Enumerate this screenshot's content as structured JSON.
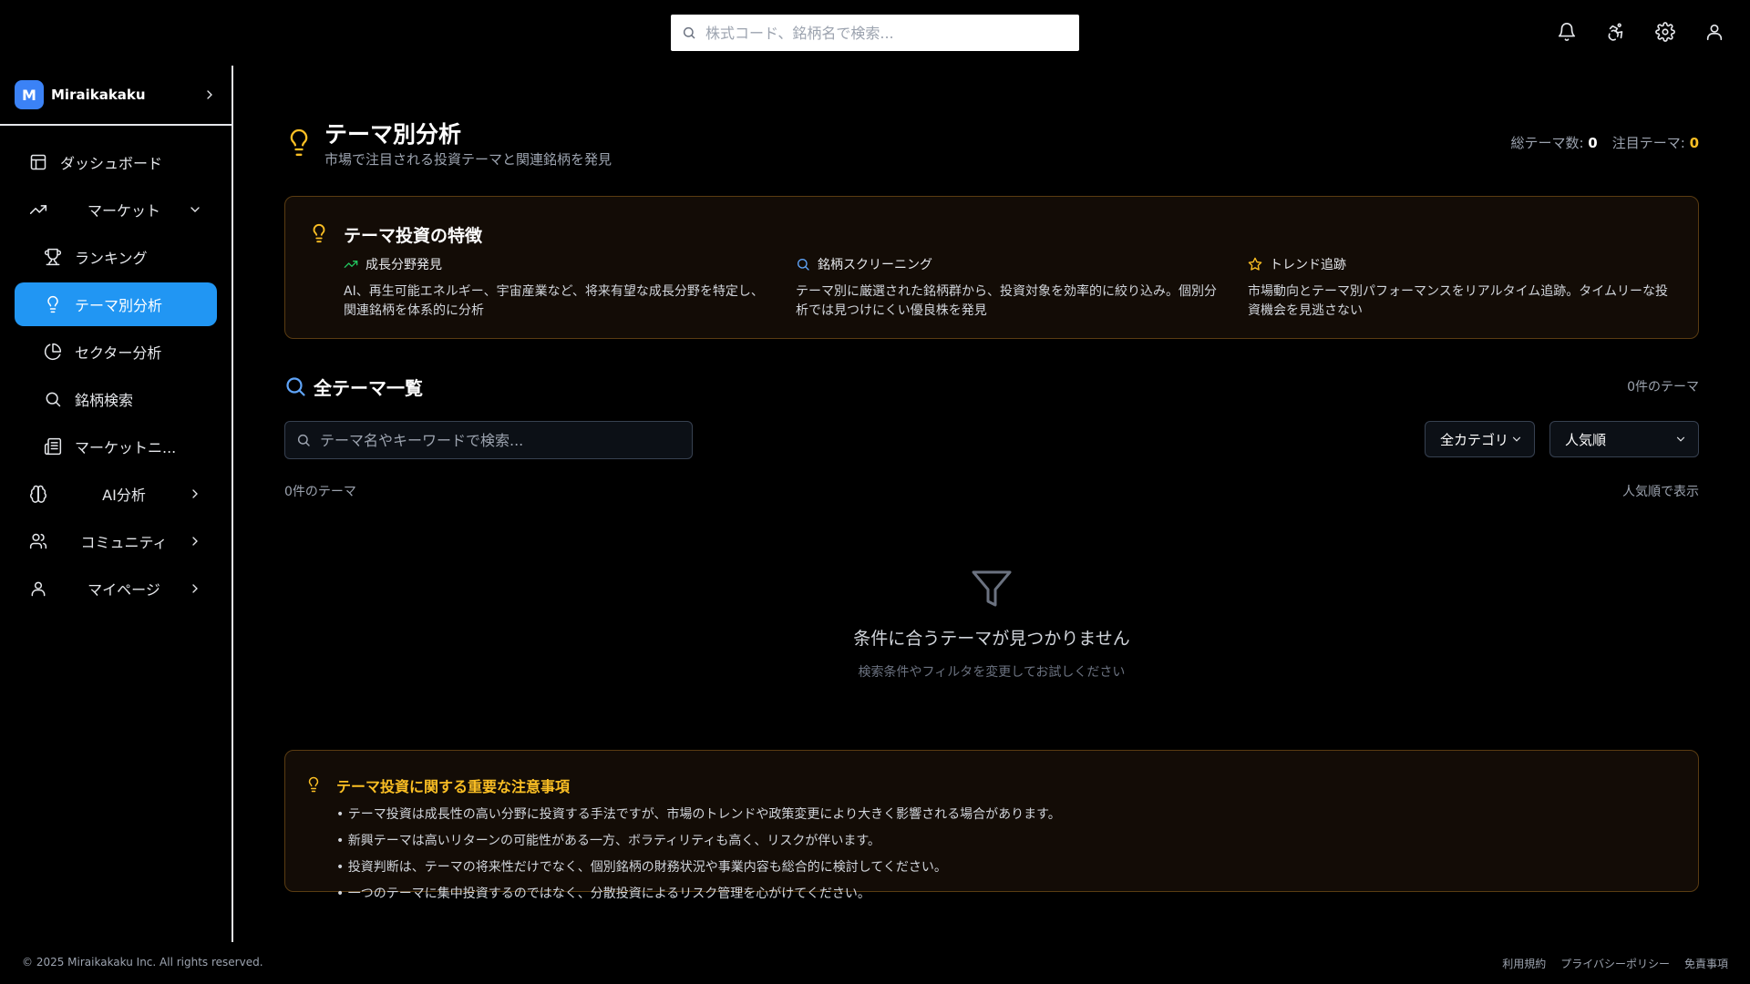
{
  "topbar": {
    "search_placeholder": "株式コード、銘柄名で検索...",
    "icons": [
      "search-icon",
      "bell-icon",
      "accessibility-icon",
      "gear-icon",
      "user-icon"
    ]
  },
  "brand": {
    "logo_letter": "M",
    "name": "Miraikakaku"
  },
  "sidebar": {
    "items": [
      {
        "label": "ダッシュボード",
        "icon": "layout-icon"
      },
      {
        "label": "マーケット",
        "icon": "trending-up-icon",
        "expanded": true
      },
      {
        "label": "ランキング",
        "icon": "trophy-icon"
      },
      {
        "label": "テーマ別分析",
        "icon": "lightbulb-icon",
        "active": true
      },
      {
        "label": "セクター分析",
        "icon": "pie-chart-icon"
      },
      {
        "label": "銘柄検索",
        "icon": "search-icon"
      },
      {
        "label": "マーケットニ...",
        "icon": "newspaper-icon"
      },
      {
        "label": "AI分析",
        "icon": "brain-icon"
      },
      {
        "label": "コミュニティ",
        "icon": "users-icon"
      },
      {
        "label": "マイページ",
        "icon": "user-icon"
      }
    ]
  },
  "header": {
    "title": "テーマ別分析",
    "subtitle": "市場で注目される投資テーマと関連銘柄を発見",
    "stats": {
      "total_label": "総テーマ数:",
      "total_value": "0",
      "hot_label": "注目テーマ:",
      "hot_value": "0"
    }
  },
  "features": {
    "title": "テーマ投資の特徴",
    "items": [
      {
        "title": "成長分野発見",
        "icon": "trending-up-icon",
        "desc": "AI、再生可能エネルギー、宇宙産業など、将来有望な成長分野を特定し、関連銘柄を体系的に分析"
      },
      {
        "title": "銘柄スクリーニング",
        "icon": "search-icon",
        "desc": "テーマ別に厳選された銘柄群から、投資対象を効率的に絞り込み。個別分析では見つけにくい優良株を発見"
      },
      {
        "title": "トレンド追跡",
        "icon": "star-icon",
        "desc": "市場動向とテーマ別パフォーマンスをリアルタイム追跡。タイムリーな投資機会を見逃さない"
      }
    ]
  },
  "list": {
    "title": "全テーマ一覧",
    "count_label": "0件のテーマ",
    "search_placeholder": "テーマ名やキーワードで検索...",
    "category_selected": "全カテゴリ",
    "sort_selected": "人気順",
    "result_count": "0件のテーマ",
    "sort_display": "人気順で表示"
  },
  "empty": {
    "title": "条件に合うテーマが見つかりません",
    "subtitle": "検索条件やフィルタを変更してお試しください"
  },
  "notice": {
    "title": "テーマ投資に関する重要な注意事項",
    "items": [
      "テーマ投資は成長性の高い分野に投資する手法ですが、市場のトレンドや政策変更により大きく影響される場合があります。",
      "新興テーマは高いリターンの可能性がある一方、ボラティリティも高く、リスクが伴います。",
      "投資判断は、テーマの将来性だけでなく、個別銘柄の財務状況や事業内容も総合的に検討してください。",
      "一つのテーマに集中投資するのではなく、分散投資によるリスク管理を心がけてください。"
    ]
  },
  "footer": {
    "copyright": "© 2025 Miraikakaku Inc. All rights reserved.",
    "links": [
      "利用規約",
      "プライバシーポリシー",
      "免責事項"
    ]
  },
  "colors": {
    "accent": "#2196f3",
    "warning": "#fbbf24",
    "card_bg": "#130c06",
    "card_border": "#5a3c12"
  }
}
